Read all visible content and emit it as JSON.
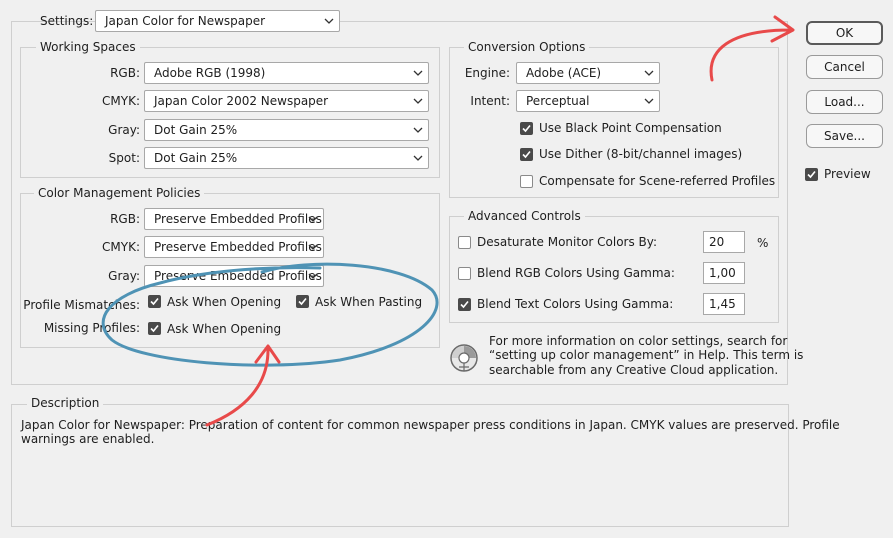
{
  "settings": {
    "label": "Settings:",
    "value": "Japan Color for Newspaper"
  },
  "working_spaces": {
    "title": "Working Spaces",
    "rows": [
      {
        "label": "RGB:",
        "value": "Adobe RGB (1998)"
      },
      {
        "label": "CMYK:",
        "value": "Japan Color 2002 Newspaper"
      },
      {
        "label": "Gray:",
        "value": "Dot Gain 25%"
      },
      {
        "label": "Spot:",
        "value": "Dot Gain 25%"
      }
    ]
  },
  "policies": {
    "title": "Color Management Policies",
    "rows": [
      {
        "label": "RGB:",
        "value": "Preserve Embedded Profiles"
      },
      {
        "label": "CMYK:",
        "value": "Preserve Embedded Profiles"
      },
      {
        "label": "Gray:",
        "value": "Preserve Embedded Profiles"
      }
    ],
    "mismatches": {
      "label": "Profile Mismatches:",
      "opening": "Ask When Opening",
      "pasting": "Ask When Pasting"
    },
    "missing": {
      "label": "Missing Profiles:",
      "opening": "Ask When Opening"
    }
  },
  "conversion": {
    "title": "Conversion Options",
    "engine_label": "Engine:",
    "engine_value": "Adobe (ACE)",
    "intent_label": "Intent:",
    "intent_value": "Perceptual",
    "options": [
      {
        "label": "Use Black Point Compensation",
        "checked": true
      },
      {
        "label": "Use Dither (8-bit/channel images)",
        "checked": true
      },
      {
        "label": "Compensate for Scene-referred Profiles",
        "checked": false
      }
    ]
  },
  "advanced": {
    "title": "Advanced Controls",
    "rows": [
      {
        "label": "Desaturate Monitor Colors By:",
        "value": "20",
        "unit": "%",
        "checked": false
      },
      {
        "label": "Blend RGB Colors Using Gamma:",
        "value": "1,00",
        "unit": "",
        "checked": false
      },
      {
        "label": "Blend Text Colors Using Gamma:",
        "value": "1,45",
        "unit": "",
        "checked": true
      }
    ]
  },
  "info": {
    "line1": "For more information on color settings, search for",
    "line2": "“setting up color management” in Help. This term is",
    "line3": "searchable from any Creative Cloud application."
  },
  "buttons": {
    "ok": "OK",
    "cancel": "Cancel",
    "load": "Load...",
    "save": "Save..."
  },
  "preview": {
    "label": "Preview",
    "checked": true
  },
  "description": {
    "title": "Description",
    "line1": "Japan Color for Newspaper:  Preparation of content for common newspaper press conditions in Japan. CMYK values are preserved. Profile",
    "line2": "warnings are enabled."
  },
  "annotation_colors": {
    "arrow": "#e84a4a",
    "ellipse": "#4f93b5"
  }
}
